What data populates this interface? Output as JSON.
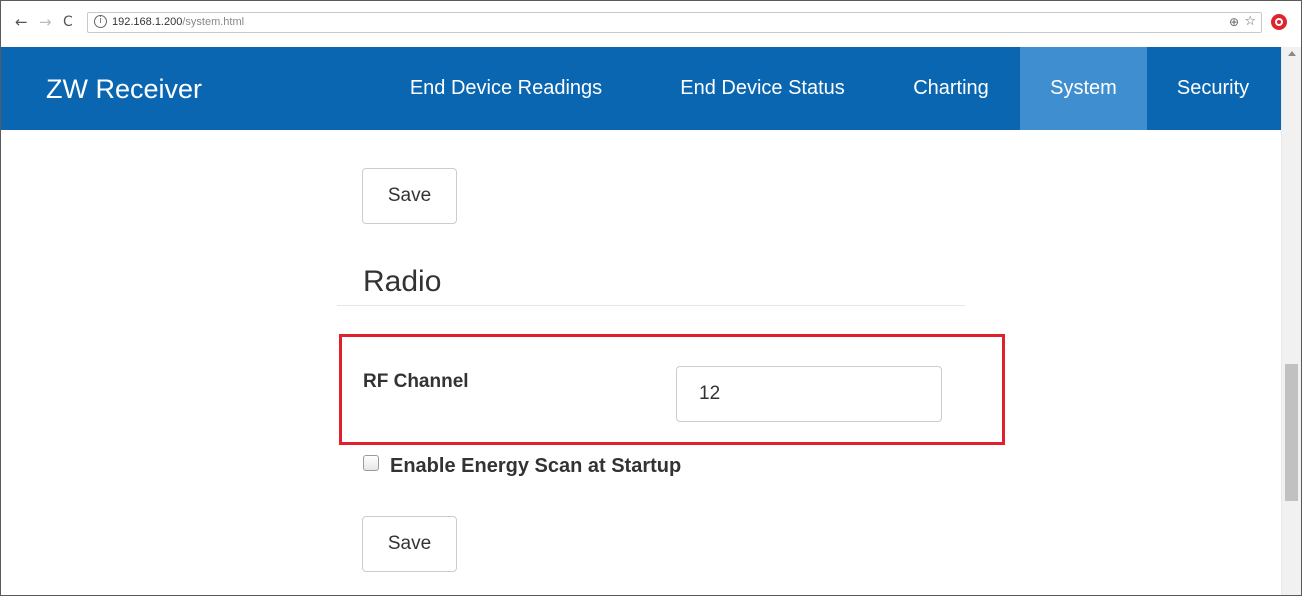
{
  "browser": {
    "url_host": "192.168.1.200",
    "url_path": "/system.html",
    "info_glyph": "i",
    "zoom_glyph": "⊕",
    "star_glyph": "☆",
    "back_glyph": "←",
    "forward_glyph": "→",
    "reload_glyph": "C"
  },
  "navbar": {
    "brand": "ZW Receiver",
    "items": [
      {
        "label": "End Device Readings",
        "active": false
      },
      {
        "label": "End Device Status",
        "active": false
      },
      {
        "label": "Charting",
        "active": false
      },
      {
        "label": "System",
        "active": true
      },
      {
        "label": "Security",
        "active": false
      }
    ],
    "color": "#0a66b0",
    "active_color": "#3f8ed0"
  },
  "main": {
    "save_top_label": "Save",
    "section_title": "Radio",
    "rf_channel_label": "RF Channel",
    "rf_channel_value": "12",
    "energy_scan_label": "Enable Energy Scan at Startup",
    "energy_scan_checked": false,
    "save_bottom_label": "Save",
    "highlight_color": "#e0202a"
  }
}
